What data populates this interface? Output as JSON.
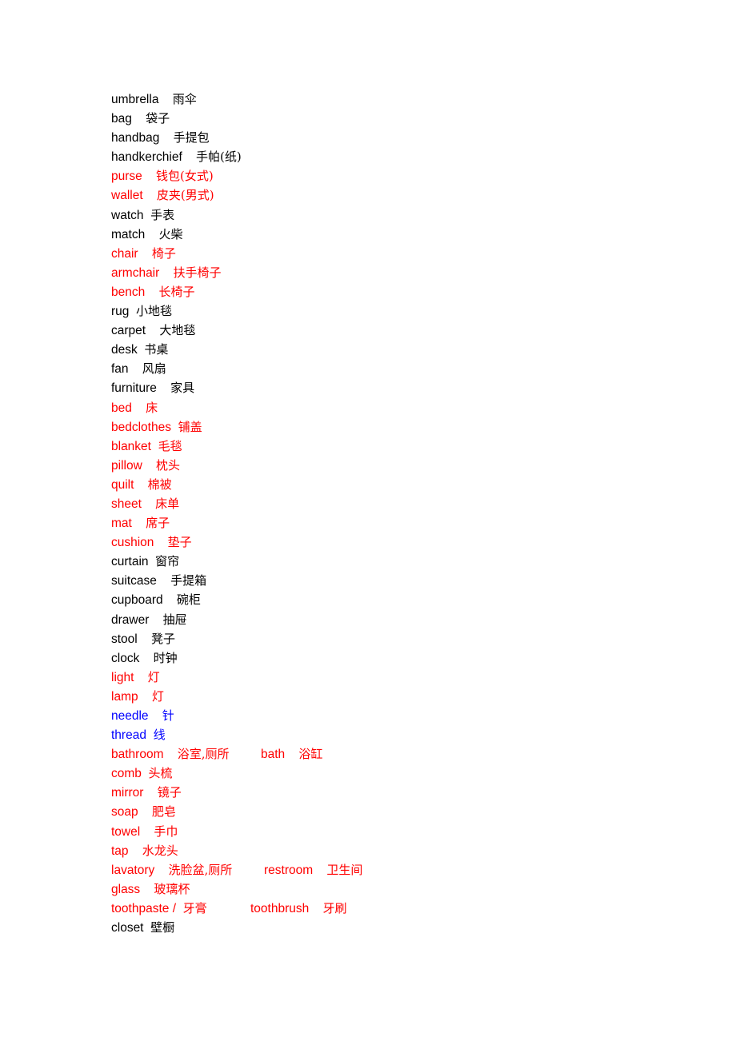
{
  "colors": {
    "black": "#000000",
    "red": "#ff0000",
    "blue": "#0000ff"
  },
  "entries": [
    {
      "en": "umbrella",
      "sep": "    ",
      "zh": "雨伞",
      "color": "black"
    },
    {
      "en": "bag",
      "sep": "    ",
      "zh": "袋子",
      "color": "black"
    },
    {
      "en": "handbag",
      "sep": "    ",
      "zh": "手提包",
      "color": "black"
    },
    {
      "en": "handkerchief",
      "sep": "    ",
      "zh": "手帕(纸)",
      "color": "black"
    },
    {
      "en": "purse",
      "sep": "    ",
      "zh": "钱包(女式)",
      "color": "red"
    },
    {
      "en": "wallet",
      "sep": "    ",
      "zh": "皮夹(男式)",
      "color": "red"
    },
    {
      "en": "watch",
      "sep": "  ",
      "zh": "手表",
      "color": "black"
    },
    {
      "en": "match",
      "sep": "    ",
      "zh": "火柴",
      "color": "black"
    },
    {
      "en": "chair",
      "sep": "    ",
      "zh": "椅子",
      "color": "red"
    },
    {
      "en": "armchair",
      "sep": "    ",
      "zh": "扶手椅子",
      "color": "red"
    },
    {
      "en": "bench",
      "sep": "    ",
      "zh": "长椅子",
      "color": "red"
    },
    {
      "en": "rug",
      "sep": "  ",
      "zh": "小地毯",
      "color": "black"
    },
    {
      "en": "carpet",
      "sep": "    ",
      "zh": "大地毯",
      "color": "black"
    },
    {
      "en": "desk",
      "sep": "  ",
      "zh": "书桌",
      "color": "black"
    },
    {
      "en": "fan",
      "sep": "    ",
      "zh": "风扇",
      "color": "black"
    },
    {
      "en": "furniture",
      "sep": "    ",
      "zh": "家具",
      "color": "black"
    },
    {
      "en": "bed",
      "sep": "    ",
      "zh": "床",
      "color": "red"
    },
    {
      "en": "bedclothes",
      "sep": "  ",
      "zh": "铺盖",
      "color": "red"
    },
    {
      "en": "blanket",
      "sep": "  ",
      "zh": "毛毯",
      "color": "red"
    },
    {
      "en": "pillow",
      "sep": "    ",
      "zh": "枕头",
      "color": "red"
    },
    {
      "en": "quilt",
      "sep": "    ",
      "zh": "棉被",
      "color": "red"
    },
    {
      "en": "sheet",
      "sep": "    ",
      "zh": "床单",
      "color": "red"
    },
    {
      "en": "mat",
      "sep": "    ",
      "zh": "席子",
      "color": "red"
    },
    {
      "en": "cushion",
      "sep": "    ",
      "zh": "垫子",
      "color": "red"
    },
    {
      "en": "curtain",
      "sep": "  ",
      "zh": "窗帘",
      "color": "black"
    },
    {
      "en": "suitcase",
      "sep": "    ",
      "zh": "手提箱",
      "color": "black"
    },
    {
      "en": "cupboard",
      "sep": "    ",
      "zh": "碗柜",
      "color": "black"
    },
    {
      "en": "drawer",
      "sep": "    ",
      "zh": "抽屉",
      "color": "black"
    },
    {
      "en": "stool",
      "sep": "    ",
      "zh": "凳子",
      "color": "black"
    },
    {
      "en": "clock",
      "sep": "    ",
      "zh": "时钟",
      "color": "black"
    },
    {
      "en": "light",
      "sep": "    ",
      "zh": "灯",
      "color": "red"
    },
    {
      "en": "lamp",
      "sep": "    ",
      "zh": "灯",
      "color": "red"
    },
    {
      "en": "needle",
      "sep": "    ",
      "zh": "针",
      "color": "blue"
    },
    {
      "en": "thread",
      "sep": "  ",
      "zh": "线",
      "color": "blue"
    },
    {
      "en": "bathroom",
      "sep": "    ",
      "zh": "浴室,厕所",
      "color": "red",
      "en2": "bath",
      "zh2": "浴缸"
    },
    {
      "en": "comb",
      "sep": "  ",
      "zh": "头梳",
      "color": "red"
    },
    {
      "en": "mirror",
      "sep": "    ",
      "zh": "镜子",
      "color": "red"
    },
    {
      "en": "soap",
      "sep": "    ",
      "zh": "肥皂",
      "color": "red"
    },
    {
      "en": "towel",
      "sep": "    ",
      "zh": "手巾",
      "color": "red"
    },
    {
      "en": "tap",
      "sep": "    ",
      "zh": "水龙头",
      "color": "red"
    },
    {
      "en": "lavatory",
      "sep": "    ",
      "zh": "洗脸盆,厕所",
      "color": "red",
      "en2": "restroom",
      "zh2": "卫生间"
    },
    {
      "en": "glass",
      "sep": "    ",
      "zh": "玻璃杯",
      "color": "red"
    },
    {
      "en": "toothpaste /",
      "sep": "  ",
      "zh": "牙膏",
      "color": "red",
      "en2": "toothbrush",
      "zh2": "牙刷"
    },
    {
      "en": "closet",
      "sep": "  ",
      "zh": "壁橱",
      "color": "black"
    }
  ]
}
